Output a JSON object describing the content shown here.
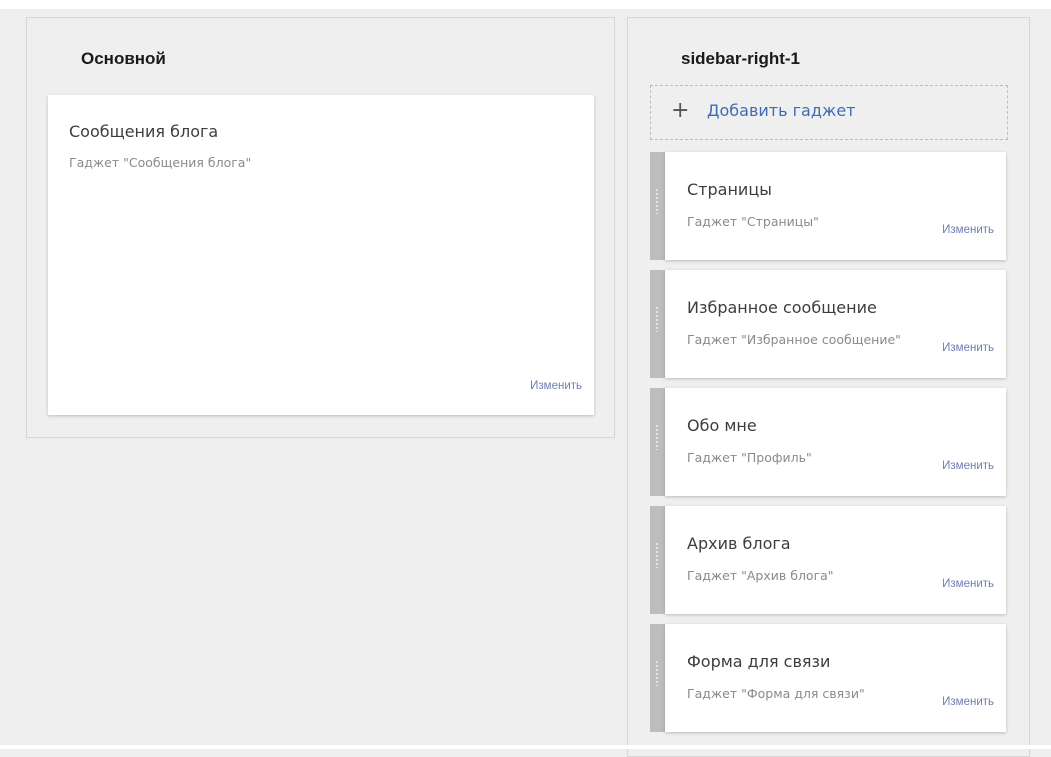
{
  "main_section": {
    "title": "Основной",
    "gadget": {
      "title": "Сообщения блога",
      "subtitle": "Гаджет \"Сообщения блога\"",
      "edit_label": "Изменить"
    }
  },
  "sidebar_section": {
    "title": "sidebar-right-1",
    "add_gadget": {
      "plus": "+",
      "label": "Добавить гаджет"
    },
    "gadgets": [
      {
        "title": "Страницы",
        "subtitle": "Гаджет \"Страницы\"",
        "edit_label": "Изменить"
      },
      {
        "title": "Избранное сообщение",
        "subtitle": "Гаджет \"Избранное сообщение\"",
        "edit_label": "Изменить"
      },
      {
        "title": "Обо мне",
        "subtitle": "Гаджет \"Профиль\"",
        "edit_label": "Изменить"
      },
      {
        "title": "Архив блога",
        "subtitle": "Гаджет \"Архив блога\"",
        "edit_label": "Изменить"
      },
      {
        "title": "Форма для связи",
        "subtitle": "Гаджет \"Форма для связи\"",
        "edit_label": "Изменить"
      }
    ]
  },
  "colors": {
    "background": "#eeeeee",
    "card": "#ffffff",
    "accent_link": "#3f6bb5",
    "edit_link": "#6b7fb0",
    "drag_handle": "#bdbdbd"
  }
}
